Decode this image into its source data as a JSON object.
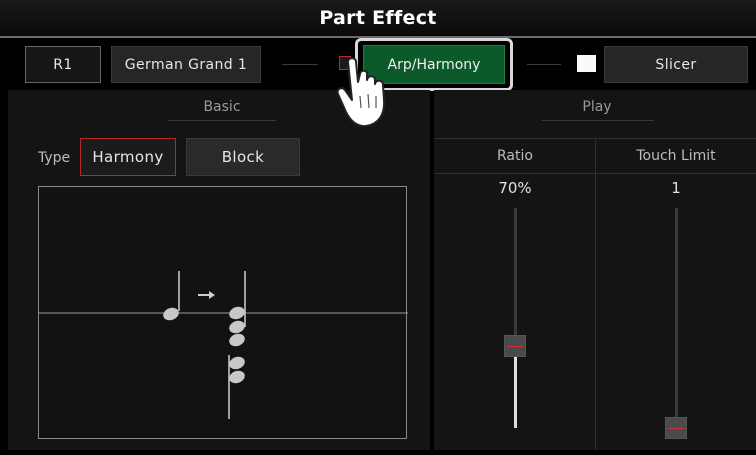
{
  "header": {
    "title": "Part Effect"
  },
  "toolbar": {
    "part": "R1",
    "voice": "German Grand 1",
    "arp_harmony": "Arp/Harmony",
    "slicer": "Slicer",
    "arp_enabled": false,
    "slicer_enabled": true
  },
  "basic": {
    "section_label": "Basic",
    "type_label": "Type",
    "options": [
      "Harmony",
      "Block"
    ],
    "selected": "Harmony"
  },
  "play": {
    "section_label": "Play",
    "ratio": {
      "header": "Ratio",
      "value": "70%",
      "level": 0.7
    },
    "touch_limit": {
      "header": "Touch Limit",
      "value": "1",
      "level": 0.0
    }
  },
  "colors": {
    "accent_green": "#0c5a2a",
    "selection_red": "#b72828",
    "slider_mark": "#d03030"
  },
  "icons": {
    "cursor": "hand-pointer-icon",
    "arrow": "arrow-right-icon",
    "notes": "music-note-icon"
  }
}
